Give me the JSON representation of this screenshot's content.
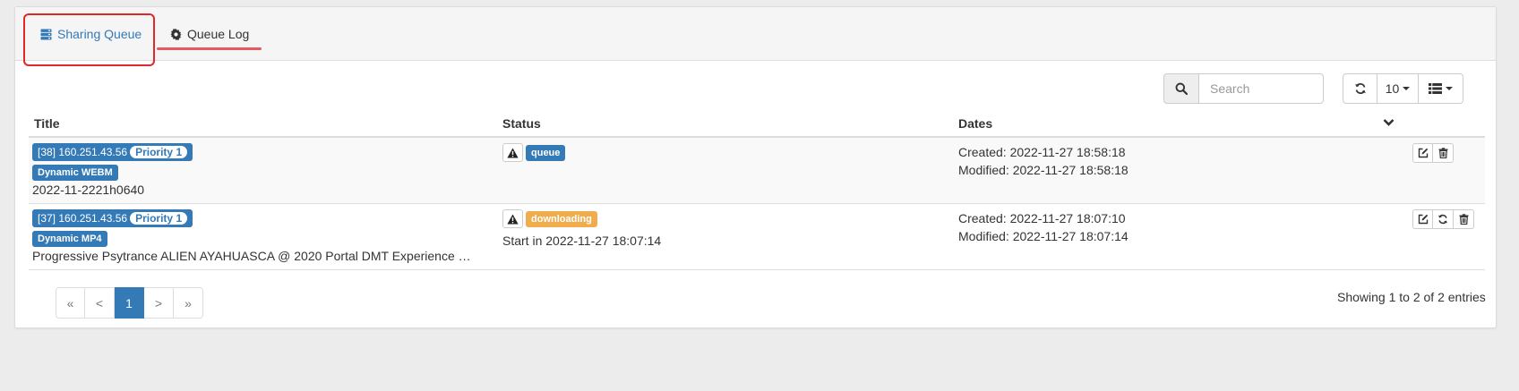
{
  "tabs": [
    {
      "label": "Sharing Queue"
    },
    {
      "label": "Queue Log"
    }
  ],
  "toolbar": {
    "search_placeholder": "Search",
    "page_size": "10"
  },
  "table": {
    "headers": {
      "title": "Title",
      "status": "Status",
      "dates": "Dates"
    },
    "rows": [
      {
        "id_label": "[38] 160.251.43.56",
        "priority": "Priority 1",
        "type": "Dynamic WEBM",
        "title": "2022-11-2221h0640",
        "status_badge": "queue",
        "status_sub": "",
        "created": "Created: 2022-11-27 18:58:18",
        "modified": "Modified: 2022-11-27 18:58:18"
      },
      {
        "id_label": "[37] 160.251.43.56",
        "priority": "Priority 1",
        "type": "Dynamic MP4",
        "title": "Progressive Psytrance ALIEN AYAHUASCA @ 2020 Portal DMT Experience …",
        "status_badge": "downloading",
        "status_sub": "Start in 2022-11-27 18:07:14",
        "created": "Created: 2022-11-27 18:07:10",
        "modified": "Modified: 2022-11-27 18:07:14"
      }
    ]
  },
  "pagination": {
    "first": "«",
    "prev": "<",
    "current": "1",
    "next": ">",
    "last": "»"
  },
  "entries_text": "Showing 1 to 2 of 2 entries",
  "colors": {
    "primary": "#337ab7",
    "warning": "#f0ad4e",
    "highlight": "#e0272b"
  }
}
